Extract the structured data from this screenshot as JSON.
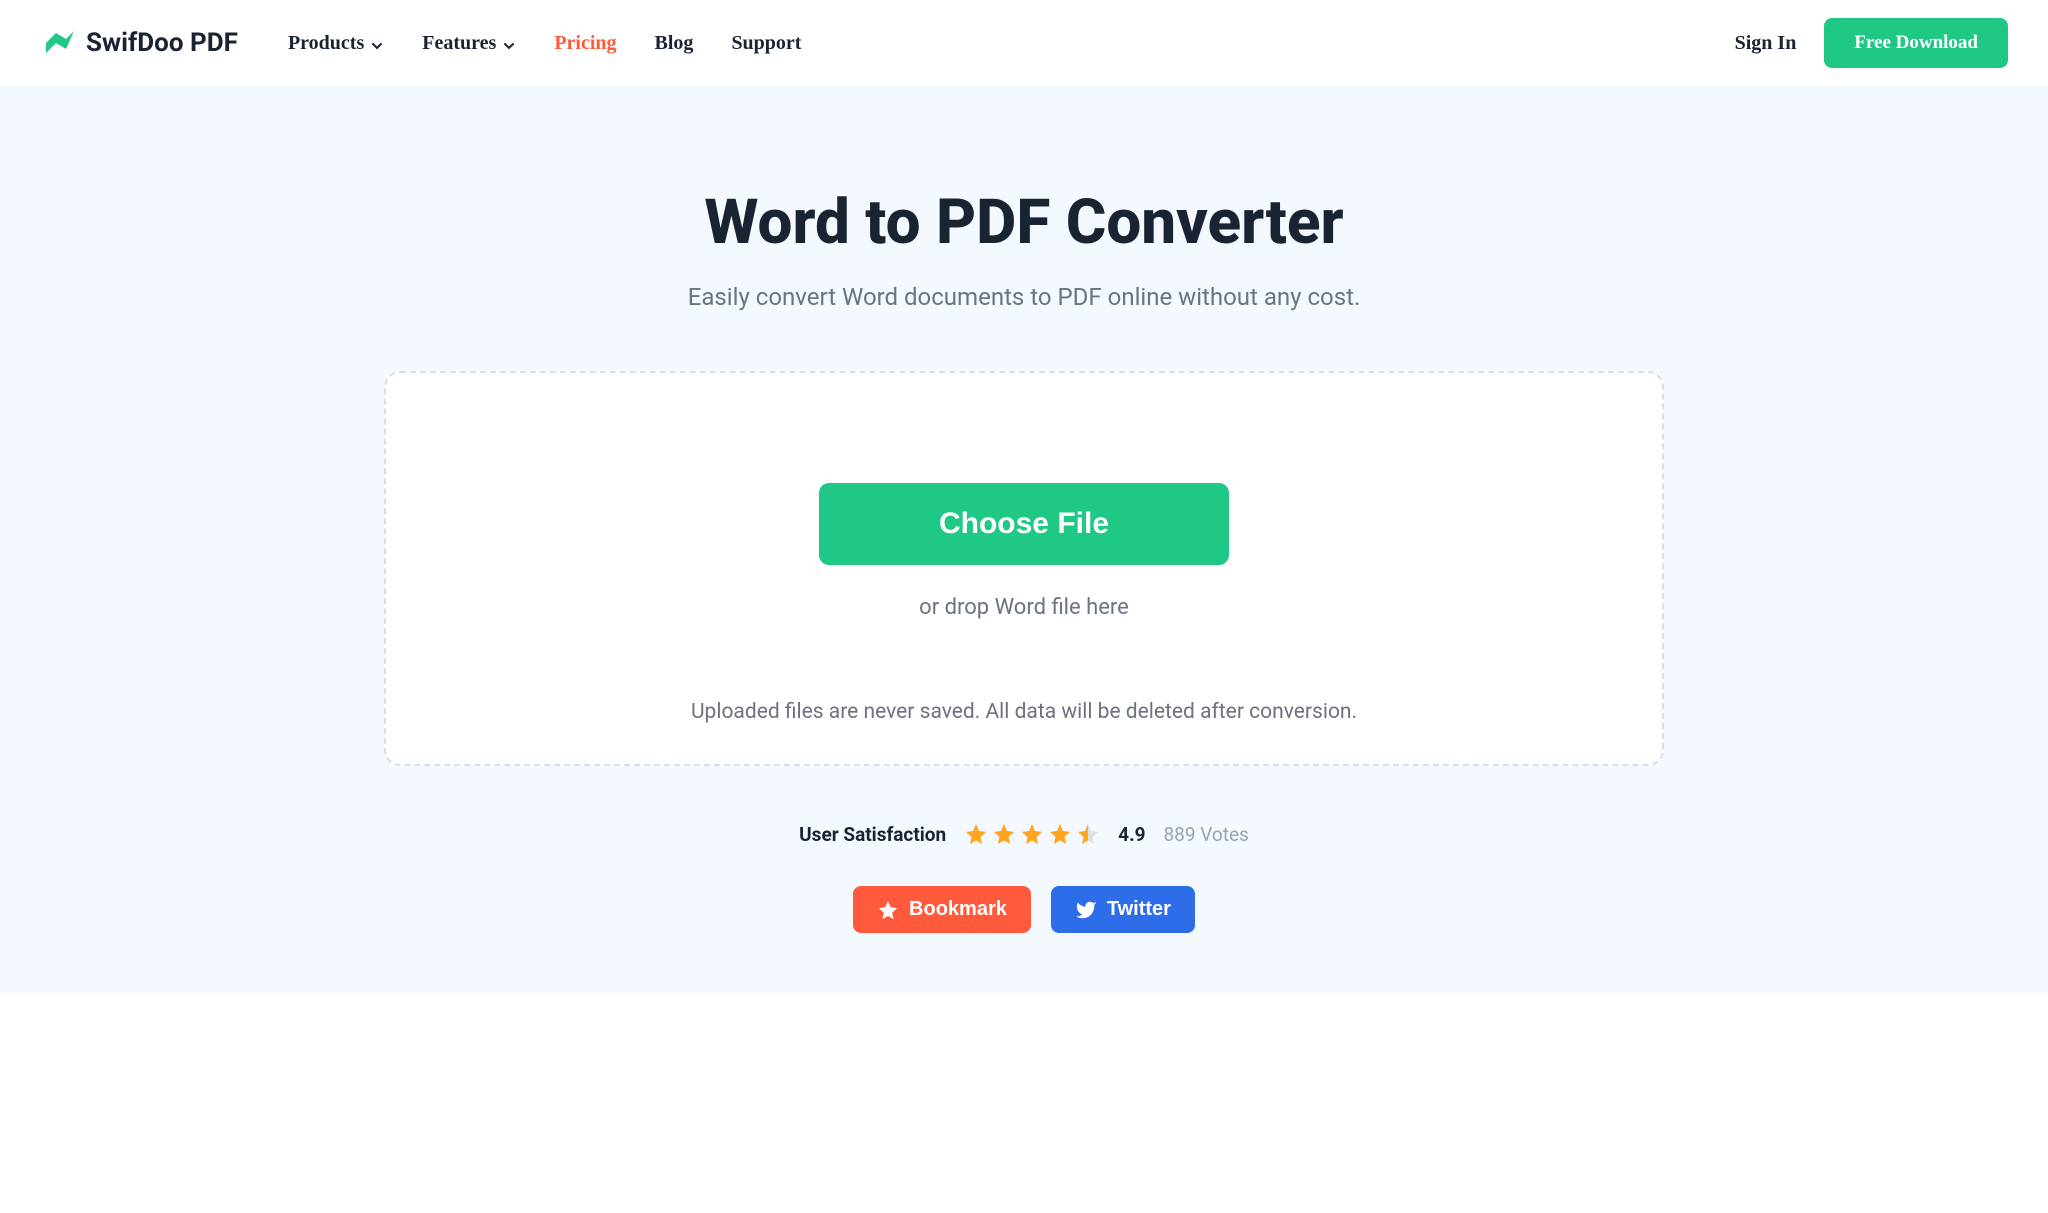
{
  "header": {
    "brand": "SwifDoo PDF",
    "nav": {
      "products": "Products",
      "features": "Features",
      "pricing": "Pricing",
      "blog": "Blog",
      "support": "Support"
    },
    "sign_in": "Sign In",
    "download": "Free Download"
  },
  "main": {
    "title": "Word to PDF Converter",
    "subtitle": "Easily convert Word documents to PDF online without any cost.",
    "choose_file": "Choose File",
    "drop_text": "or drop Word file here",
    "privacy_text": "Uploaded files are never saved. All data will be deleted after conversion."
  },
  "satisfaction": {
    "label": "User Satisfaction",
    "score": "4.9",
    "votes": "889 Votes"
  },
  "share": {
    "bookmark": "Bookmark",
    "twitter": "Twitter"
  }
}
